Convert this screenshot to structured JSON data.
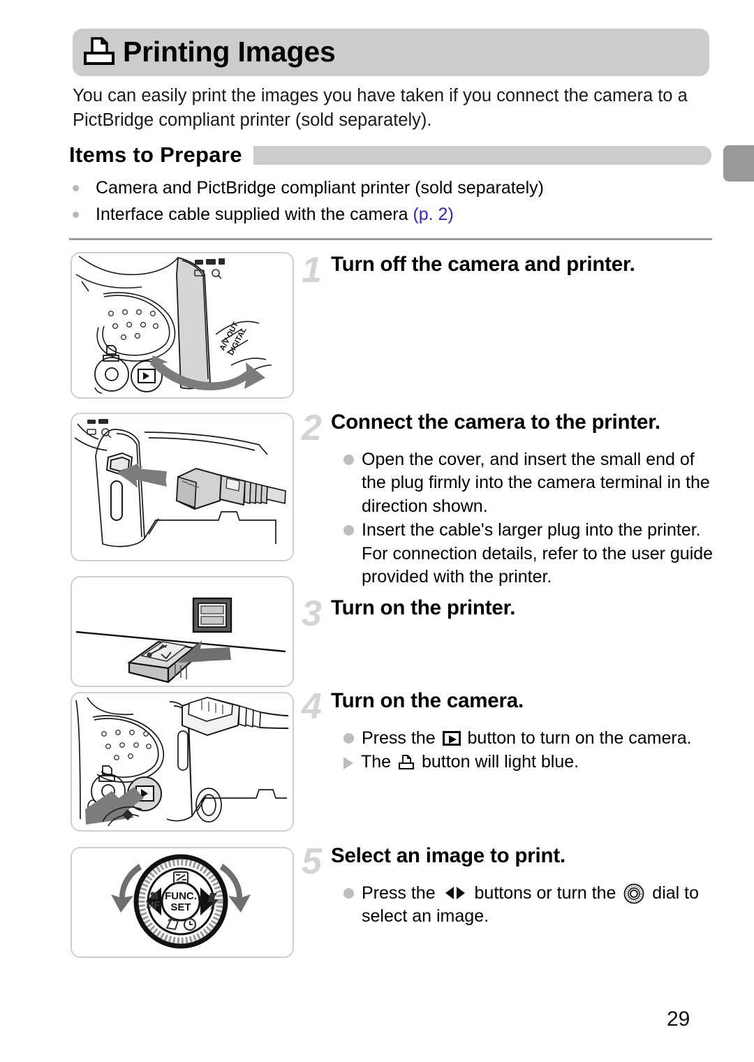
{
  "header": {
    "icon": "printer-icon",
    "title": "Printing Images",
    "banner_color": "#cccccc"
  },
  "intro": "You can easily print the images you have taken if you connect the camera to a PictBridge compliant printer (sold separately).",
  "section": {
    "heading": "Items to Prepare",
    "bar_color": "#cccccc",
    "edge_tab_color": "#999999"
  },
  "prep_items": [
    {
      "text": "Camera and PictBridge compliant printer (sold separately)",
      "ref": ""
    },
    {
      "text": "Interface cable supplied with the camera ",
      "ref": "(p. 2)"
    }
  ],
  "link_color": "#2727d4",
  "steps": [
    {
      "number": "1",
      "title": "Turn off the camera and printer.",
      "bullets": [],
      "figure": "camera-cover-open-illustration"
    },
    {
      "number": "2",
      "title": "Connect the camera to the printer.",
      "bullets": [
        {
          "marker": "dot",
          "text": "Open the cover, and insert the small end of the plug firmly into the camera terminal in the direction shown."
        },
        {
          "marker": "dot",
          "text": "Insert the cable's larger plug into the printer. For connection details, refer to the user guide provided with the printer."
        }
      ],
      "figure": "camera-terminal-plug-illustration"
    },
    {
      "number": "3",
      "title": "Turn on the printer.",
      "bullets": [],
      "figure": "usb-plug-printer-port-illustration"
    },
    {
      "number": "4",
      "title": "Turn on the camera.",
      "bullets": [
        {
          "marker": "dot",
          "pre": "Press the ",
          "icon": "playback-button-icon",
          "post": " button to turn on the camera."
        },
        {
          "marker": "triangle",
          "pre": "The ",
          "icon": "print-button-icon",
          "post": " button will light blue."
        }
      ],
      "figure": "press-playback-button-illustration"
    },
    {
      "number": "5",
      "title": "Select an image to print.",
      "bullets": [
        {
          "marker": "dot",
          "pre": "Press the ",
          "icon": "left-right-buttons-icon",
          "mid": " buttons or turn the ",
          "icon2": "control-dial-icon",
          "post": " dial to select an image."
        }
      ],
      "figure": "control-dial-illustration"
    }
  ],
  "figure_labels": {
    "av_out_digital": "A/V OUT DIGITAL",
    "func_set": "FUNC. SET",
    "mf": "MF"
  },
  "page_number": "29"
}
